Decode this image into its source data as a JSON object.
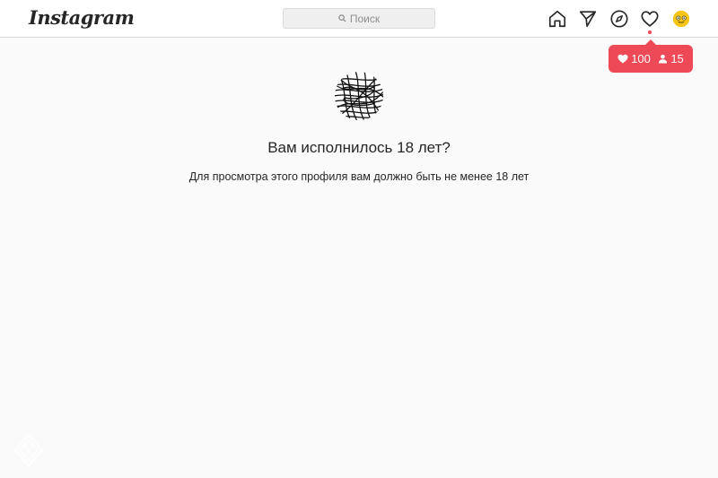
{
  "header": {
    "logo": "Instagram",
    "search_placeholder": "Поиск",
    "icons": [
      "home-icon",
      "direct-icon",
      "explore-icon",
      "activity-icon",
      "profile-avatar"
    ]
  },
  "notification": {
    "likes": "100",
    "followers": "15",
    "color": "#ed4956"
  },
  "main": {
    "title": "Вам исполнилось 18 лет?",
    "subtitle": "Для просмотра этого профиля вам должно быть не менее 18 лет"
  }
}
